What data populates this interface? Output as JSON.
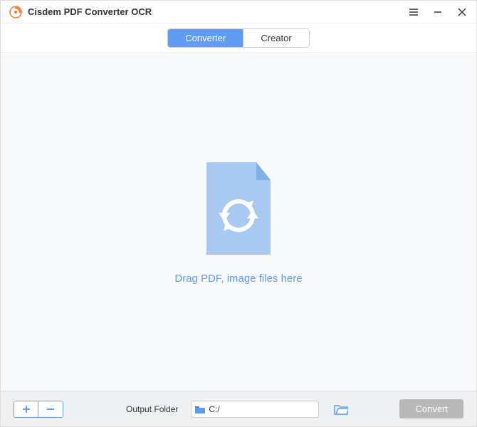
{
  "app": {
    "title": "Cisdem PDF Converter OCR"
  },
  "tabs": {
    "converter": "Converter",
    "creator": "Creator"
  },
  "dropzone": {
    "text": "Drag PDF, image files here"
  },
  "footer": {
    "output_label": "Output Folder",
    "output_path": "C:/",
    "convert_label": "Convert"
  }
}
